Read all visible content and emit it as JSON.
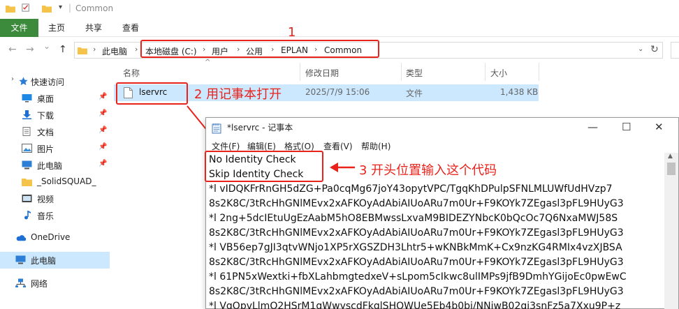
{
  "titlebar": {
    "title": "Common",
    "divider": "|"
  },
  "ribbon": {
    "tabs": [
      "文件",
      "主页",
      "共享",
      "查看"
    ]
  },
  "address": {
    "crumbs": [
      "此电脑",
      "本地磁盘 (C:)",
      "用户",
      "公用",
      "EPLAN",
      "Common"
    ],
    "nav": {
      "back": "←",
      "forward": "→",
      "dropdown": "⌄",
      "up": "↑"
    },
    "refresh": "↻"
  },
  "sidebar": {
    "items": [
      {
        "label": "快速访问",
        "icon": "star-icon"
      },
      {
        "label": "桌面",
        "icon": "desktop-icon"
      },
      {
        "label": "下载",
        "icon": "download-icon"
      },
      {
        "label": "文档",
        "icon": "document-icon"
      },
      {
        "label": "图片",
        "icon": "picture-icon"
      },
      {
        "label": "此电脑",
        "icon": "computer-icon"
      },
      {
        "label": "_SolidSQUAD_",
        "icon": "folder-icon"
      },
      {
        "label": "视频",
        "icon": "video-icon"
      },
      {
        "label": "音乐",
        "icon": "music-icon"
      },
      {
        "label": "OneDrive",
        "icon": "cloud-icon"
      },
      {
        "label": "此电脑",
        "icon": "computer-icon"
      },
      {
        "label": "网络",
        "icon": "network-icon"
      }
    ],
    "pin_glyph": "📌",
    "expand_glyph": "›"
  },
  "filelist": {
    "columns": [
      "名称",
      "修改日期",
      "类型",
      "大小"
    ],
    "rows": [
      {
        "name": "lservrc",
        "date": "2025/7/9 15:06",
        "type": "文件",
        "size": "1,438 KB"
      }
    ]
  },
  "annotations": {
    "label1": "1",
    "label2": "2 用记事本打开",
    "label3": "3 开头位置输入这个代码"
  },
  "notepad": {
    "title": "*lservrc - 记事本",
    "buttons": {
      "minimize": "—",
      "maximize": "☐",
      "close": "✕"
    },
    "menu": [
      "文件(F)",
      "编辑(E)",
      "格式(O)",
      "查看(V)",
      "帮助(H)"
    ],
    "lines": [
      "No Identity Check",
      "Skip Identity Check",
      "*l vIDQKFrRnGH5dZG+Pa0cqMg67joY43opytVPC/TgqKhDPulpSFNLMLUWfUdHVzp7",
      "8s2K8C/3tRcHhGNlMEvx2xAFKOyAdAbiAIUoARu7m0Ur+F9KOYk7ZEgasl3pFL9HUyG3",
      "*l 2ng+5dcIEtuUgEzAabM5hO8EBMwssLxvaM9BIDEZYNbcK0bQcOc7Q6NxaMWJ58S",
      "8s2K8C/3tRcHhGNlMEvx2xAFKOyAdAbiAIUoARu7m0Ur+F9KOYk7ZEgasl3pFL9HUyG3",
      "*l VB56ep7gJI3qtvWNjo1XP5rXGSZDH3Lhtr5+wKNBkMmK+Cx9nzKG4RMIx4vzXJBSA",
      "8s2K8C/3tRcHhGNlMEvx2xAFKOyAdAbiAIUoARu7m0Ur+F9KOYk7ZEgasl3pFL9HUyG3",
      "*l 61PN5xWextki+fbXLahbmgtedxeV+sLpom5cIkwc8ulIMPs9jfB9DmhYGijoEc0pwEwC",
      "8s2K8C/3tRcHhGNlMEvx2xAFKOyAdAbiAIUoARu7m0Ur+F9KOYk7ZEgasl3pFL9HUyG3",
      "*l VqOpvLlmO2HSrM1gWwyscdFkqlSHOWUe5Eb4b0bi/NNiwB02qj3snFz5a7Xxu9P+z"
    ]
  },
  "colors": {
    "accent_red": "#e8231c",
    "file_tab_green": "#3c8a3c",
    "selection_blue": "#cce8ff"
  }
}
